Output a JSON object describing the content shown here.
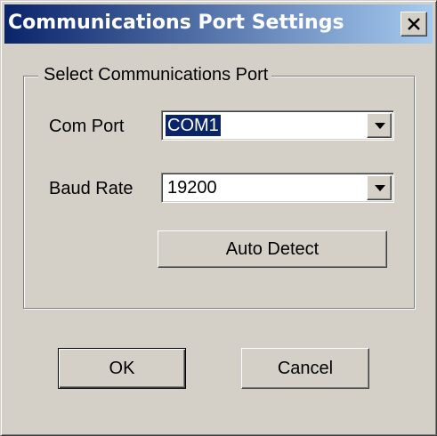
{
  "window": {
    "title": "Communications Port Settings",
    "close_label": "close",
    "colors": {
      "titlebar_start": "#0a246a",
      "titlebar_end": "#a6caf0",
      "face": "#d4d0c8"
    }
  },
  "group": {
    "legend": "Select Communications Port",
    "com_port": {
      "label": "Com Port",
      "value": "COM1"
    },
    "baud_rate": {
      "label": "Baud Rate",
      "value": "19200"
    },
    "auto_detect_label": "Auto Detect"
  },
  "buttons": {
    "ok_label": "OK",
    "cancel_label": "Cancel"
  },
  "icons": {
    "close": "close-icon",
    "dropdown": "chevron-down-icon"
  }
}
